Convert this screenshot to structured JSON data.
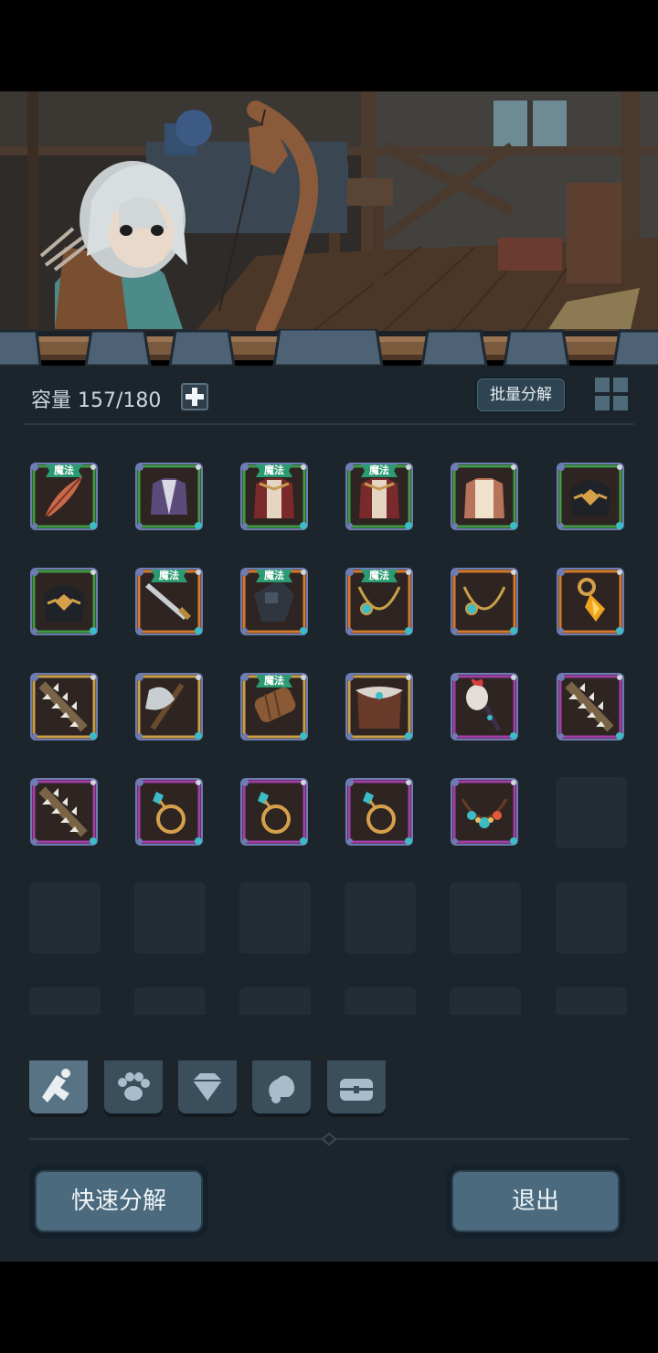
{
  "capacity": {
    "label": "容量 157/180"
  },
  "toolbar": {
    "batch_label": "批量分解"
  },
  "item_tag": "魔法",
  "items": [
    {
      "name": "feather-icon",
      "rarity": "green",
      "tag": true
    },
    {
      "name": "purple-vest-icon",
      "rarity": "green",
      "tag": false
    },
    {
      "name": "red-robe-icon",
      "rarity": "green",
      "tag": true
    },
    {
      "name": "red-robe-icon",
      "rarity": "green",
      "tag": true
    },
    {
      "name": "cream-robe-icon",
      "rarity": "green",
      "tag": false
    },
    {
      "name": "dark-helm-icon",
      "rarity": "green",
      "tag": false
    },
    {
      "name": "dark-helm-icon",
      "rarity": "green",
      "tag": false
    },
    {
      "name": "greatsword-icon",
      "rarity": "orange",
      "tag": true
    },
    {
      "name": "dark-gauntlet-icon",
      "rarity": "orange",
      "tag": true
    },
    {
      "name": "gold-necklace-icon",
      "rarity": "orange",
      "tag": true
    },
    {
      "name": "gold-necklace-icon",
      "rarity": "orange",
      "tag": false
    },
    {
      "name": "amber-earring-icon",
      "rarity": "orange",
      "tag": false
    },
    {
      "name": "spiked-club-icon",
      "rarity": "gold",
      "tag": false
    },
    {
      "name": "battle-axe-icon",
      "rarity": "gold",
      "tag": false
    },
    {
      "name": "leather-bracer-icon",
      "rarity": "gold",
      "tag": true
    },
    {
      "name": "fur-armor-icon",
      "rarity": "gold",
      "tag": false
    },
    {
      "name": "bone-staff-icon",
      "rarity": "purple",
      "tag": false
    },
    {
      "name": "spiked-club-icon",
      "rarity": "purple",
      "tag": false
    },
    {
      "name": "spiked-club-icon",
      "rarity": "purple",
      "tag": false
    },
    {
      "name": "gem-ring-icon",
      "rarity": "purple",
      "tag": false
    },
    {
      "name": "gem-ring-icon",
      "rarity": "purple",
      "tag": false
    },
    {
      "name": "gem-ring-icon",
      "rarity": "purple",
      "tag": false
    },
    {
      "name": "bead-necklace-icon",
      "rarity": "purple",
      "tag": false
    }
  ],
  "categories": [
    {
      "name": "weapon-category-icon",
      "active": true
    },
    {
      "name": "pet-paw-icon",
      "active": false
    },
    {
      "name": "gem-icon",
      "active": false
    },
    {
      "name": "material-icon",
      "active": false
    },
    {
      "name": "chest-icon",
      "active": false
    }
  ],
  "footer": {
    "quick_decompose_label": "快速分解",
    "exit_label": "退出"
  },
  "colors": {
    "green": "#3f9a45",
    "orange": "#d47a2c",
    "gold": "#c9a04a",
    "purple": "#a13ea7",
    "panel": "#1c252c",
    "tag": "#2c9a72"
  }
}
